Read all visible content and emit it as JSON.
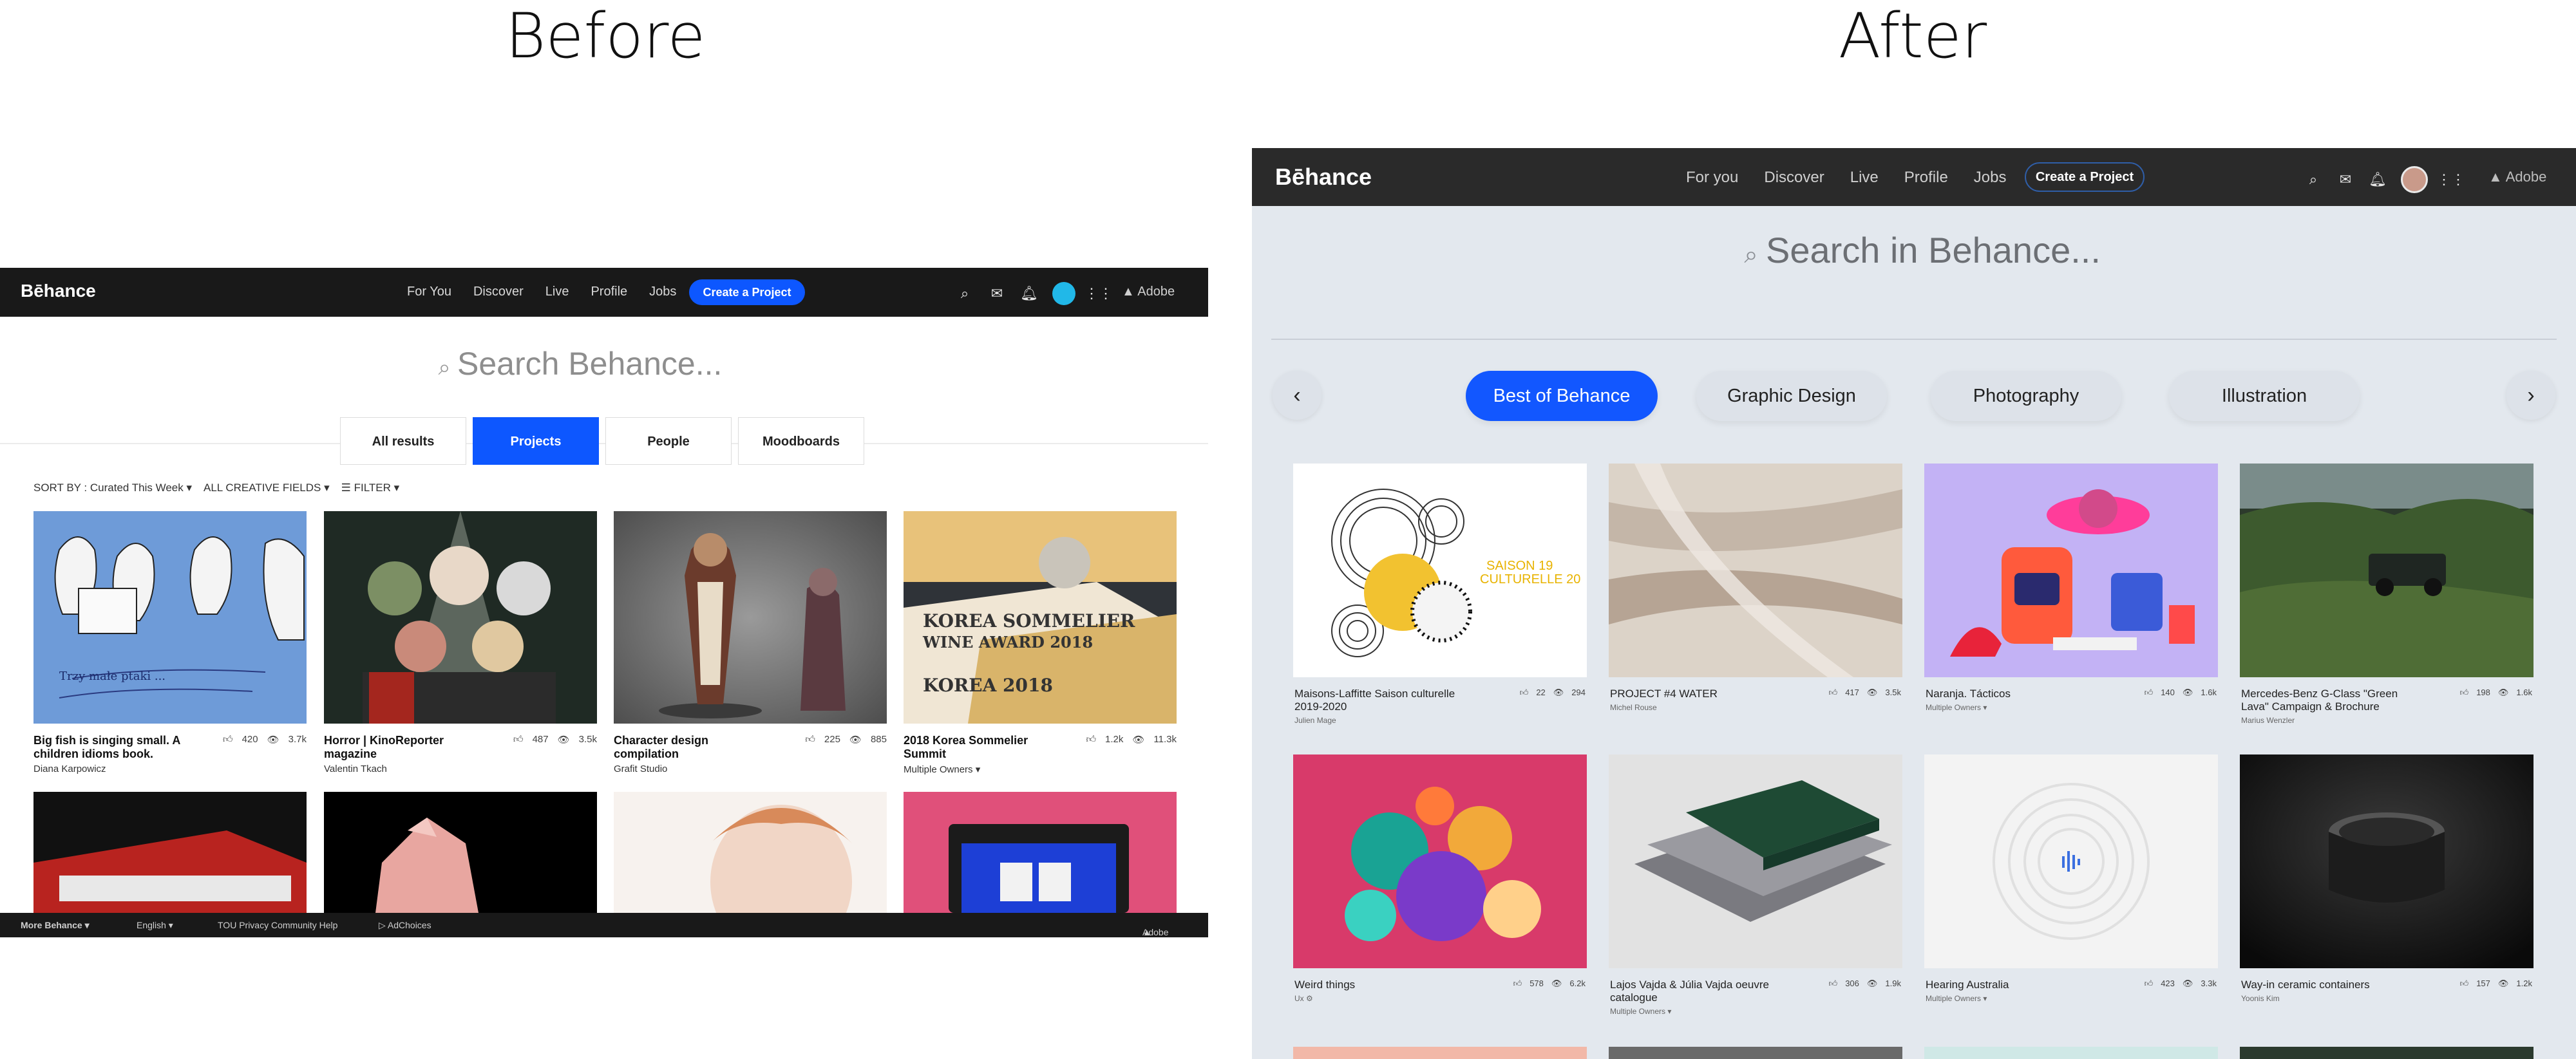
{
  "headings": {
    "before": "Before",
    "after": "After"
  },
  "before": {
    "logo": "Bēhance",
    "nav": [
      "For You",
      "Discover",
      "Live",
      "Profile",
      "Jobs"
    ],
    "create_button": "Create a Project",
    "adobe": "Adobe",
    "search_placeholder": "Search Behance...",
    "tabs": [
      "All results",
      "Projects",
      "People",
      "Moodboards"
    ],
    "sort": {
      "sort_by": "SORT BY : Curated This Week ▾",
      "fields": "ALL CREATIVE FIELDS ▾",
      "filter": "FILTER ▾"
    },
    "cards": [
      {
        "title": "Big fish is singing small. A children idioms book.",
        "owner": "Diana Karpowicz",
        "likes": "420",
        "views": "3.7k"
      },
      {
        "title": "Horror | KinoReporter magazine",
        "owner": "Valentin Tkach",
        "likes": "487",
        "views": "3.5k"
      },
      {
        "title": "Character design compilation",
        "owner": "Grafit Studio",
        "likes": "225",
        "views": "885"
      },
      {
        "title": "2018 Korea Sommelier Summit",
        "owner": "Multiple Owners ▾",
        "likes": "1.2k",
        "views": "11.3k"
      }
    ],
    "footer": {
      "more": "More Behance ▾",
      "lang": "English ▾",
      "links": "TOU   Privacy   Community   Help",
      "adchoices": "▷ AdChoices",
      "adobe": "Adobe"
    }
  },
  "after": {
    "logo": "Bēhance",
    "nav": [
      "For you",
      "Discover",
      "Live",
      "Profile",
      "Jobs"
    ],
    "create_button": "Create a Project",
    "adobe": "Adobe",
    "search_placeholder": "Search in Behance...",
    "categories": [
      "Best of Behance",
      "Graphic Design",
      "Photography",
      "Illustration"
    ],
    "cards": [
      {
        "title": "Maisons-Laffitte Saison culturelle 2019-2020",
        "owner": "Julien Mage",
        "likes": "22",
        "views": "294"
      },
      {
        "title": "PROJECT #4 WATER",
        "owner": "Michel Rouse",
        "likes": "417",
        "views": "3.5k"
      },
      {
        "title": "Naranja. Tácticos",
        "owner": "Multiple Owners ▾",
        "likes": "140",
        "views": "1.6k"
      },
      {
        "title": "Mercedes-Benz G-Class \"Green Lava\" Campaign & Brochure",
        "owner": "Marius Wenzler",
        "likes": "198",
        "views": "1.6k"
      },
      {
        "title": "Weird things",
        "owner": "Ux ⚙",
        "likes": "578",
        "views": "6.2k"
      },
      {
        "title": "Lajos Vajda & Júlia Vajda oeuvre catalogue",
        "owner": "Multiple Owners ▾",
        "likes": "306",
        "views": "1.9k"
      },
      {
        "title": "Hearing Australia",
        "owner": "Multiple Owners ▾",
        "likes": "423",
        "views": "3.3k"
      },
      {
        "title": "Way-in ceramic containers",
        "owner": "Yoonis Kim",
        "likes": "157",
        "views": "1.2k"
      }
    ]
  }
}
